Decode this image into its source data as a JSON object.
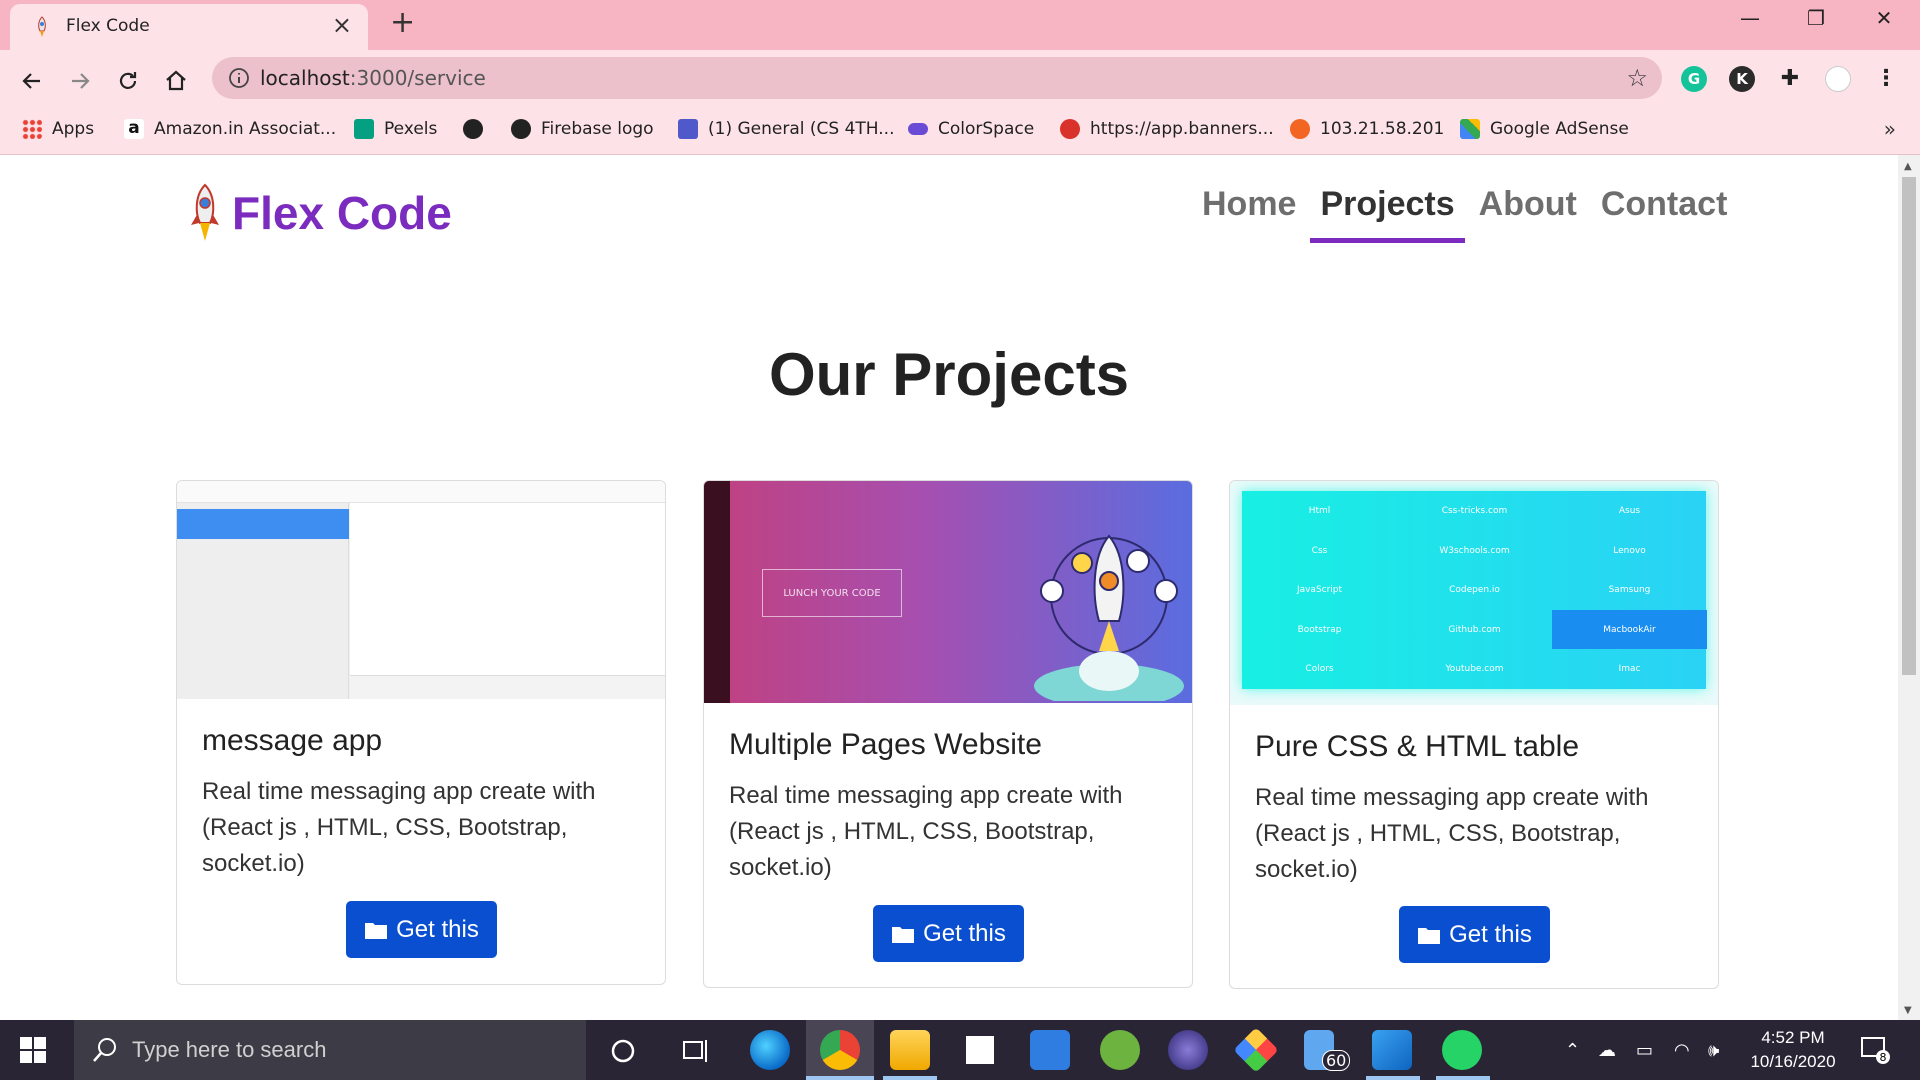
{
  "browser": {
    "tab_title": "Flex Code",
    "url_host": "localhost",
    "url_path": ":3000/service",
    "bookmarks": [
      {
        "label": "Apps",
        "color": "#e94235"
      },
      {
        "label": "Amazon.in Associat...",
        "color": "#111111"
      },
      {
        "label": "Pexels",
        "color": "#05a081"
      },
      {
        "label": "",
        "color": "#222222"
      },
      {
        "label": "Firebase logo",
        "color": "#222222"
      },
      {
        "label": "(1) General (CS 4TH...",
        "color": "#5059c9"
      },
      {
        "label": "ColorSpace",
        "color": "#6a4bd6"
      },
      {
        "label": "https://app.banners...",
        "color": "#d8322b"
      },
      {
        "label": "103.21.58.201",
        "color": "#f26522"
      },
      {
        "label": "Google AdSense",
        "color": "#fbbc04"
      }
    ],
    "extensions": [
      {
        "letter": "G",
        "color": "#15c39a"
      },
      {
        "letter": "K",
        "color": "#2b2b2b"
      }
    ]
  },
  "site": {
    "brand": "Flex Code",
    "accent": "#7b2cbf",
    "nav": [
      {
        "label": "Home",
        "active": false
      },
      {
        "label": "Projects",
        "active": true
      },
      {
        "label": "About",
        "active": false
      },
      {
        "label": "Contact",
        "active": false
      }
    ],
    "heading": "Our Projects",
    "cards": [
      {
        "title": "message app",
        "text": "Real time messaging app create with (React js , HTML, CSS, Bootstrap, socket.io)",
        "button": "Get this"
      },
      {
        "title": "Multiple Pages Website",
        "text": "Real time messaging app create with (React js , HTML, CSS, Bootstrap, socket.io)",
        "button": "Get this"
      },
      {
        "title": "Pure CSS & HTML table",
        "text": "Real time messaging app create with (React js , HTML, CSS, Bootstrap, socket.io)",
        "button": "Get this"
      }
    ],
    "card2_image_text": "LUNCH YOUR CODE",
    "card3_table": [
      "Html",
      "Css-tricks.com",
      "Asus",
      "Css",
      "W3schools.com",
      "Lenovo",
      "JavaScript",
      "Codepen.io",
      "Samsung",
      "Bootstrap",
      "Github.com",
      "MacbookAir",
      "Colors",
      "Youtube.com",
      "Imac"
    ]
  },
  "taskbar": {
    "search_placeholder": "Type here to search",
    "time": "4:52 PM",
    "date": "10/16/2020",
    "badge_count": "60",
    "notification_count": "8"
  }
}
